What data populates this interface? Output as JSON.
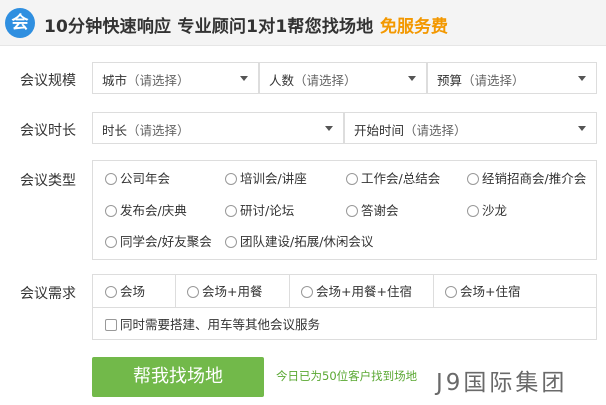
{
  "header": {
    "logo_text": "会",
    "title": "10分钟快速响应 专业顾问1对1帮您找场地",
    "free": "免服务费",
    "accent_color": "#f39800"
  },
  "scale": {
    "label": "会议规模",
    "city": {
      "label": "城市",
      "hint": "（请选择）"
    },
    "people": {
      "label": "人数",
      "hint": "（请选择）"
    },
    "budget": {
      "label": "预算",
      "hint": "（请选择）"
    }
  },
  "duration": {
    "label": "会议时长",
    "length": {
      "label": "时长",
      "hint": "（请选择）"
    },
    "start": {
      "label": "开始时间",
      "hint": "（请选择）"
    }
  },
  "type": {
    "label": "会议类型",
    "options": [
      "公司年会",
      "培训会/讲座",
      "工作会/总结会",
      "经销招商会/推介会",
      "发布会/庆典",
      "研讨/论坛",
      "答谢会",
      "沙龙",
      "同学会/好友聚会",
      "团队建设/拓展/休闲会议"
    ]
  },
  "needs": {
    "label": "会议需求",
    "options": [
      "会场",
      "会场+用餐",
      "会场+用餐+住宿",
      "会场+住宿"
    ],
    "extra": "同时需要搭建、用车等其他会议服务"
  },
  "submit": {
    "label": "帮我找场地",
    "note": "今日已为50位客户找到场地",
    "color": "#72b94a"
  },
  "watermark": "J9国际集团"
}
